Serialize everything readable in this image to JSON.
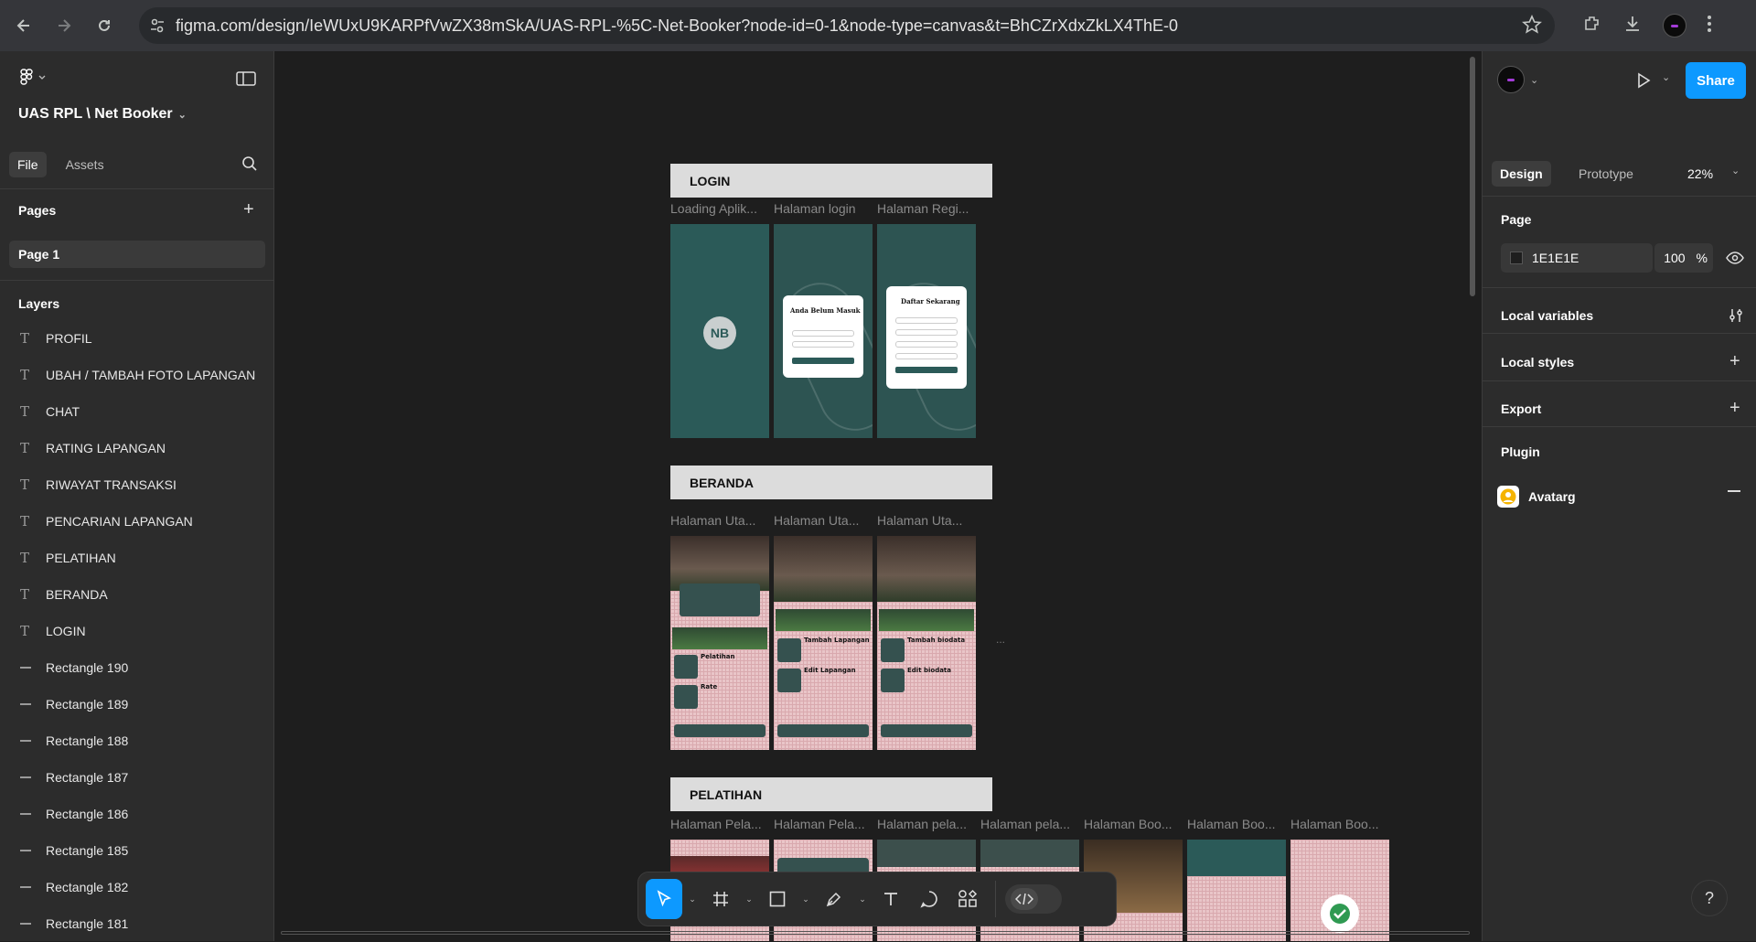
{
  "browser": {
    "url": "figma.com/design/IeWUxU9KARPfVwZX38mSkA/UAS-RPL-%5C-Net-Booker?node-id=0-1&node-type=canvas&t=BhCZrXdxZkLX4ThE-0"
  },
  "left_panel": {
    "file_title": "UAS RPL \\ Net Booker",
    "tabs": [
      "File",
      "Assets"
    ],
    "pages_label": "Pages",
    "pages": [
      "Page 1"
    ],
    "layers_label": "Layers",
    "layers": [
      {
        "type": "text",
        "name": "PROFIL"
      },
      {
        "type": "text",
        "name": "UBAH / TAMBAH FOTO LAPANGAN"
      },
      {
        "type": "text",
        "name": "CHAT"
      },
      {
        "type": "text",
        "name": "RATING LAPANGAN"
      },
      {
        "type": "text",
        "name": "RIWAYAT TRANSAKSI"
      },
      {
        "type": "text",
        "name": "PENCARIAN LAPANGAN"
      },
      {
        "type": "text",
        "name": "PELATIHAN"
      },
      {
        "type": "text",
        "name": "BERANDA"
      },
      {
        "type": "text",
        "name": "LOGIN"
      },
      {
        "type": "rect",
        "name": "Rectangle 190"
      },
      {
        "type": "rect",
        "name": "Rectangle 189"
      },
      {
        "type": "rect",
        "name": "Rectangle 188"
      },
      {
        "type": "rect",
        "name": "Rectangle 187"
      },
      {
        "type": "rect",
        "name": "Rectangle 186"
      },
      {
        "type": "rect",
        "name": "Rectangle 185"
      },
      {
        "type": "rect",
        "name": "Rectangle 182"
      },
      {
        "type": "rect",
        "name": "Rectangle 181"
      }
    ]
  },
  "canvas": {
    "sections": [
      {
        "title": "LOGIN",
        "frames": [
          "Loading Aplik...",
          "Halaman login",
          "Halaman Regi..."
        ]
      },
      {
        "title": "BERANDA",
        "frames": [
          "Halaman Uta...",
          "Halaman Uta...",
          "Halaman Uta..."
        ]
      },
      {
        "title": "PELATIHAN",
        "frames": [
          "Halaman Pela...",
          "Halaman Pela...",
          "Halaman pela...",
          "Halaman pela...",
          "Halaman Boo...",
          "Halaman Boo...",
          "Halaman Boo..."
        ]
      }
    ],
    "mockup_text": {
      "login_card_title": "Anda Belum Masuk",
      "register_card_title": "Daftar Sekarang",
      "tile_pelatihan": "Pelatihan",
      "tile_rate": "Rate",
      "tile_tambah_lapangan": "Tambah Lapangan",
      "tile_edit_lapangan": "Edit Lapangan",
      "tile_tambah_biodata": "Tambah biodata",
      "tile_edit_biodata": "Edit  biodata",
      "logo_text": "NB",
      "overflow": "..."
    }
  },
  "right_panel": {
    "share_label": "Share",
    "tabs": [
      "Design",
      "Prototype"
    ],
    "zoom": "22%",
    "page_label": "Page",
    "page_color": "1E1E1E",
    "page_opacity": "100",
    "percent": "%",
    "local_variables": "Local variables",
    "local_styles": "Local styles",
    "export": "Export",
    "plugin_label": "Plugin",
    "plugin_name": "Avatarg"
  },
  "help_label": "?",
  "colors": {
    "accent": "#0d99ff",
    "canvas": "#1e1e1e",
    "panel": "#2c2c2c",
    "mockup_teal": "#2b5a58",
    "mockup_pink": "#e9c5c8"
  }
}
